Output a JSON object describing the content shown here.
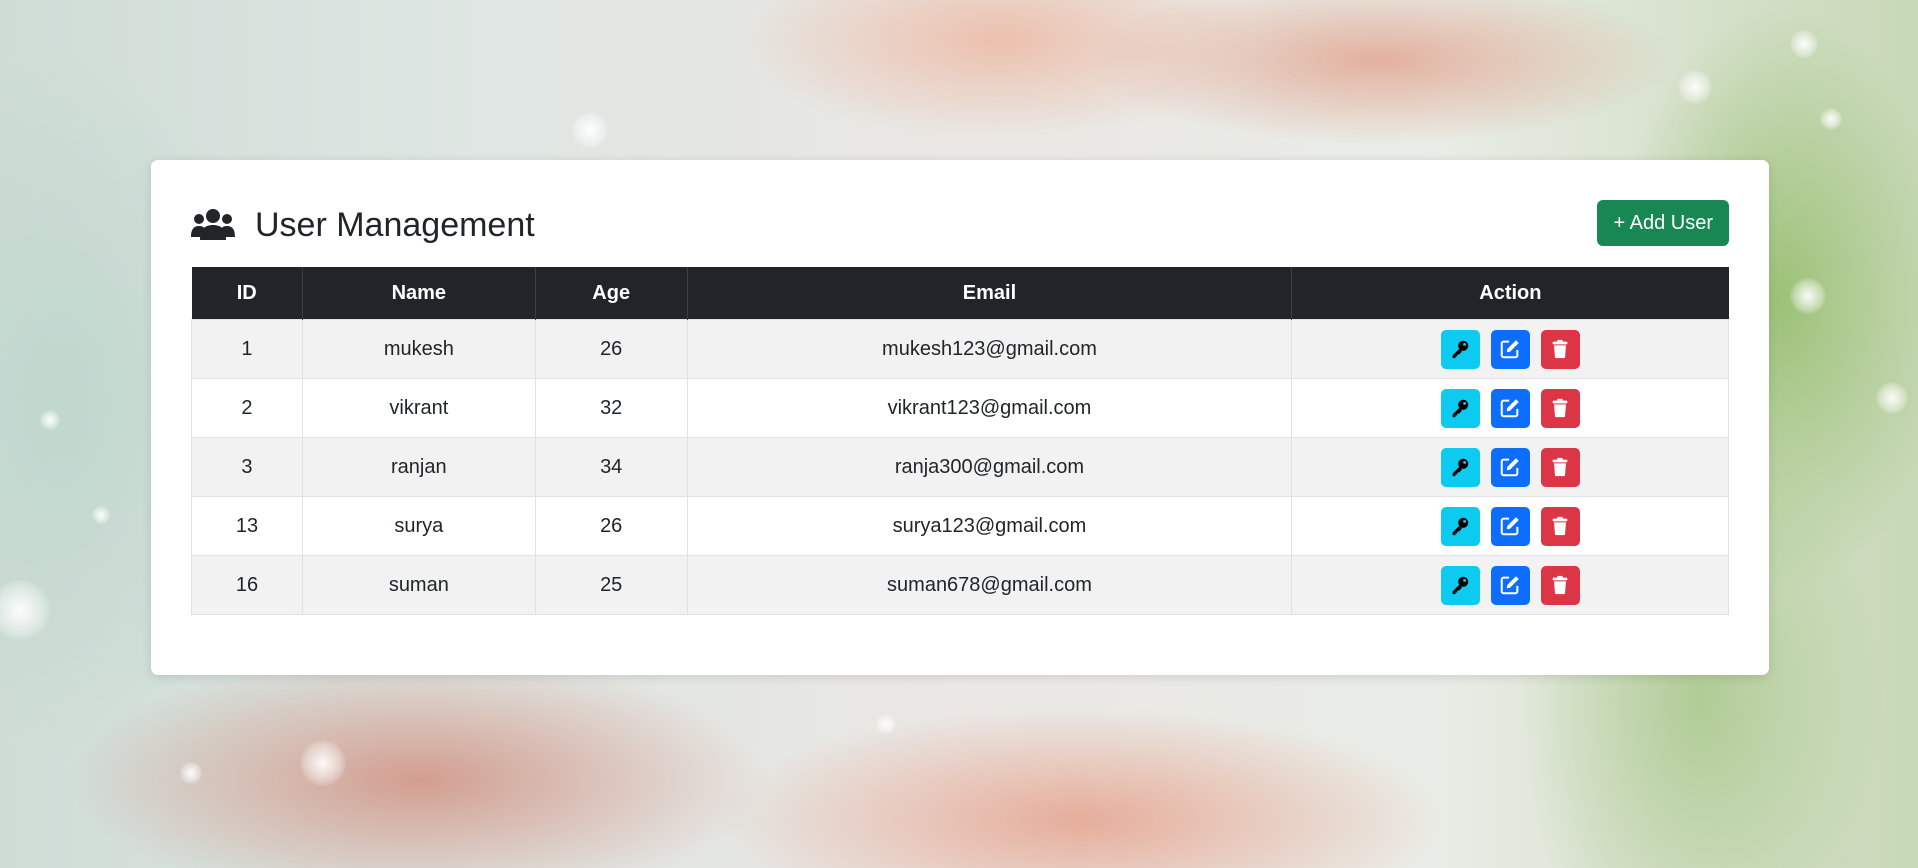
{
  "header": {
    "title": "User Management",
    "title_icon": "users-icon",
    "add_button_label": "+ Add User"
  },
  "table": {
    "columns": [
      "ID",
      "Name",
      "Age",
      "Email",
      "Action"
    ],
    "rows": [
      {
        "id": "1",
        "name": "mukesh",
        "age": "26",
        "email": "mukesh123@gmail.com"
      },
      {
        "id": "2",
        "name": "vikrant",
        "age": "32",
        "email": "vikrant123@gmail.com"
      },
      {
        "id": "3",
        "name": "ranjan",
        "age": "34",
        "email": "ranja300@gmail.com"
      },
      {
        "id": "13",
        "name": "surya",
        "age": "26",
        "email": "surya123@gmail.com"
      },
      {
        "id": "16",
        "name": "suman",
        "age": "25",
        "email": "suman678@gmail.com"
      }
    ],
    "action_icons": [
      "key-icon",
      "edit-icon",
      "trash-icon"
    ]
  },
  "colors": {
    "add_button": "#198754",
    "header_row": "#212529",
    "key_button": "#0dcaf0",
    "edit_button": "#0d6efd",
    "delete_button": "#dc3545"
  }
}
